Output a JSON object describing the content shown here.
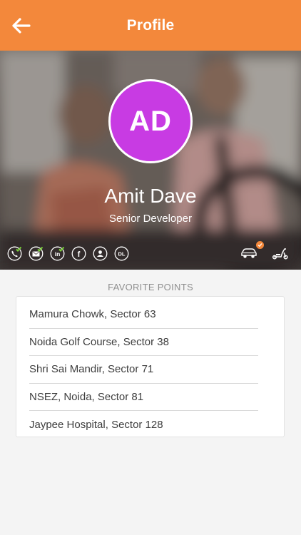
{
  "header": {
    "title": "Profile",
    "back_icon": "arrow-left-icon",
    "color": "#f3883b"
  },
  "profile": {
    "initials": "AD",
    "name": "Amit Dave",
    "job_title": "Senior Developer",
    "avatar_color": "#c83be3"
  },
  "verifications": [
    {
      "icon": "phone-icon",
      "verified": true
    },
    {
      "icon": "email-icon",
      "verified": true
    },
    {
      "icon": "linkedin-icon",
      "verified": true
    },
    {
      "icon": "facebook-icon",
      "verified": false
    },
    {
      "icon": "id-card-icon",
      "verified": false
    },
    {
      "icon": "driving-license-icon",
      "verified": false,
      "label": "DL"
    }
  ],
  "vehicles": [
    {
      "icon": "car-icon",
      "selected": true
    },
    {
      "icon": "scooter-icon",
      "selected": false
    }
  ],
  "favorites": {
    "title": "FAVORITE POINTS",
    "items": [
      "Mamura Chowk, Sector 63",
      "Noida Golf Course, Sector 38",
      "Shri Sai Mandir, Sector 71",
      "NSEZ, Noida, Sector 81",
      "Jaypee Hospital, Sector 128"
    ]
  }
}
